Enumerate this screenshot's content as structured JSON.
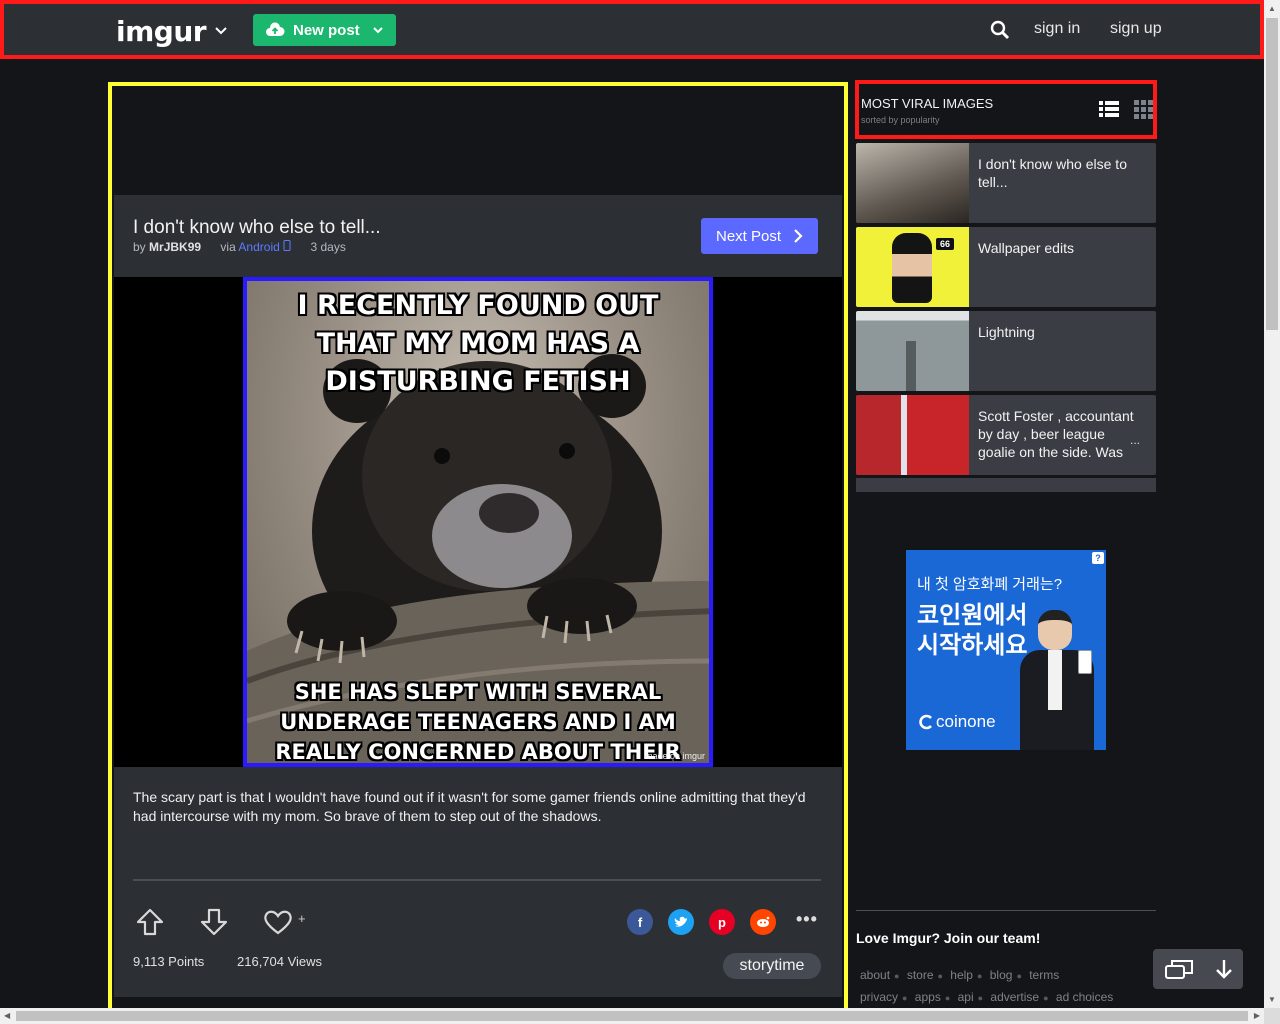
{
  "header": {
    "logo_text": "imgur",
    "new_post_label": "New post",
    "sign_in": "sign in",
    "sign_up": "sign up",
    "brand_color": "#1bb76e"
  },
  "post": {
    "title": "I don't know who else to tell...",
    "by_prefix": "by",
    "author": "MrJBK99",
    "via_prefix": "via",
    "via_platform": "Android",
    "age": "3 days",
    "next_post_label": "Next Post",
    "meme_top_text": "I recently found out that my mom has a disturbing fetish",
    "meme_bottom_text": "She has slept with several underage teenagers and I am really concerned about their well being",
    "meme_watermark": "made on imgur",
    "description": "The scary part is that I wouldn't have found out if it wasn't for some gamer friends online admitting that they'd had intercourse with my mom. So brave of them to step out of the shadows.",
    "fav_plus": "+",
    "points": "9,113 Points",
    "views": "216,704 Views",
    "tag": "storytime"
  },
  "sidebar": {
    "viral_title": "MOST VIRAL IMAGES",
    "viral_subtitle": "sorted by popularity",
    "items": [
      {
        "title": "I don't know who else to tell..."
      },
      {
        "title": "Wallpaper edits",
        "badge": "66"
      },
      {
        "title": "Lightning"
      },
      {
        "title": "Scott Foster , accountant by day , beer league goalie on the side. Was",
        "more": "..."
      }
    ],
    "ad": {
      "line1": "내 첫 암호화폐 거래는?",
      "line2": "코인원에서",
      "line3": "시작하세요",
      "brand": "coinone",
      "help": "?"
    },
    "join_text": "Love Imgur? Join our team!",
    "footer_row1": [
      "about",
      "store",
      "help",
      "blog",
      "terms"
    ],
    "footer_row2": [
      "privacy",
      "apps",
      "api",
      "advertise",
      "ad choices"
    ]
  },
  "icons": [
    "chevron-down-icon",
    "upload-cloud-icon",
    "search-icon",
    "chevron-right-icon",
    "upvote-icon",
    "downvote-icon",
    "heart-icon",
    "facebook-icon",
    "twitter-icon",
    "pinterest-icon",
    "reddit-icon",
    "list-view-icon",
    "grid-view-icon",
    "phone-icon"
  ]
}
